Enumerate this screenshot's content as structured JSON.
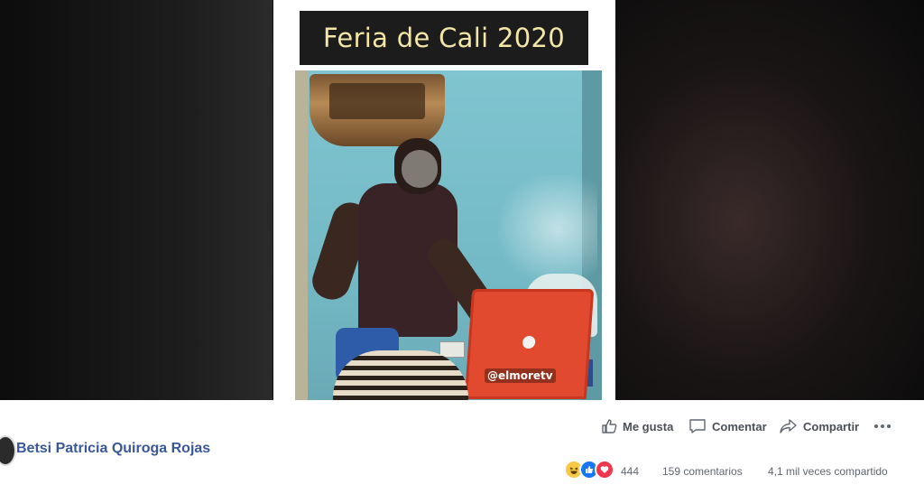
{
  "video": {
    "title_overlay": "Feria de Cali 2020",
    "watermark": "@elmoretv"
  },
  "post": {
    "author_name": "Betsi Patricia Quiroga Rojas"
  },
  "actions": {
    "like_label": "Me gusta",
    "comment_label": "Comentar",
    "share_label": "Compartir"
  },
  "stats": {
    "reaction_count": "444",
    "comments": "159 comentarios",
    "shares": "4,1 mil veces compartido"
  },
  "icons": {
    "like": "thumbs-up-icon",
    "comment": "speech-bubble-icon",
    "share": "share-arrow-icon",
    "more": "ellipsis-icon",
    "reactions": [
      "haha-reaction-icon",
      "like-reaction-icon",
      "love-reaction-icon"
    ]
  },
  "colors": {
    "author_link": "#385898",
    "action_text": "#4b4f56",
    "meta_text": "#606770",
    "like_blue": "#1877f2",
    "love_red": "#f0364f",
    "haha_yellow": "#f7c845"
  }
}
